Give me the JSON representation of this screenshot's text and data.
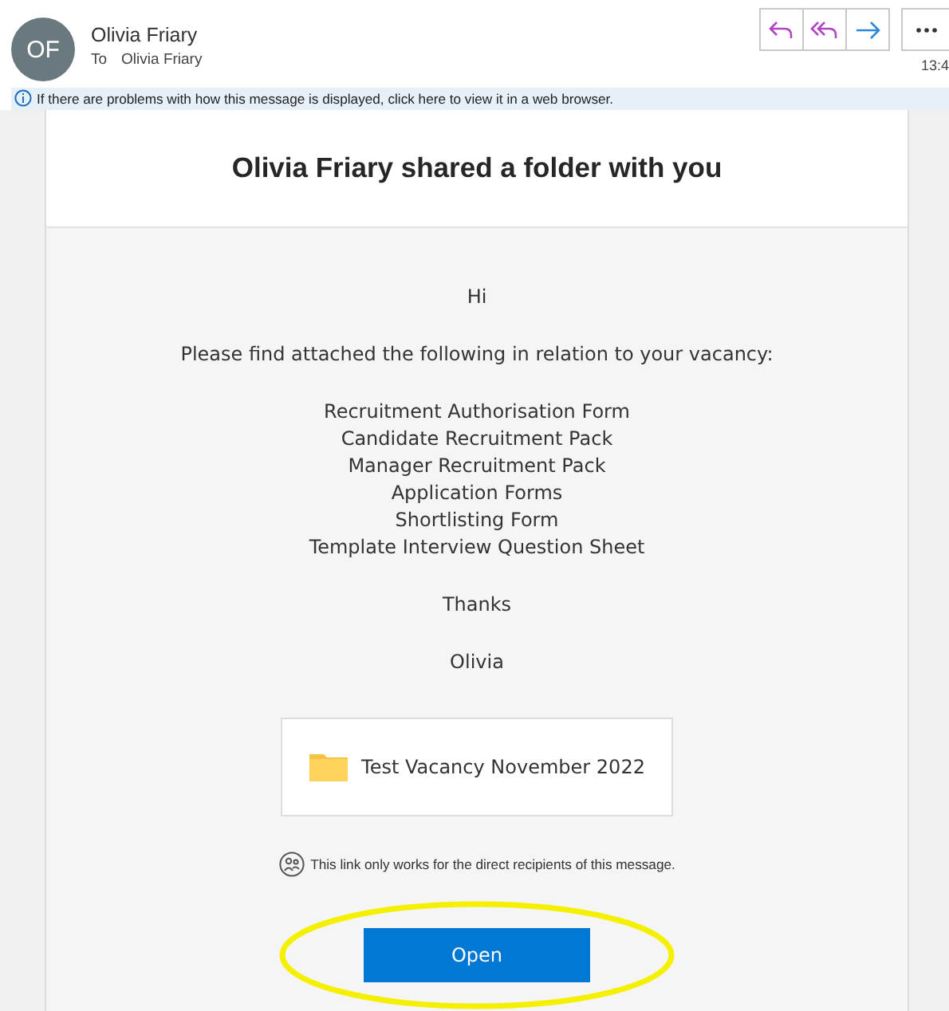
{
  "sender": {
    "initials": "OF",
    "name": "Olivia Friary",
    "to_label": "To",
    "to": "Olivia Friary",
    "time": "13:4"
  },
  "toolbar": [
    {
      "kind": "reply"
    },
    {
      "kind": "reply_all"
    },
    {
      "kind": "forward"
    },
    {
      "kind": "more"
    }
  ],
  "info_bar": "If there are problems with how this message is displayed, click here to view it in a web browser.",
  "card": {
    "title": "Olivia Friary shared a folder with you",
    "greeting": "Hi",
    "intro": "Please find attached the following in relation to your vacancy:",
    "items": [
      "Recruitment Authorisation Form",
      "Candidate Recruitment Pack",
      "Manager Recruitment Pack",
      "Application Forms",
      "Shortlisting Form",
      "Template Interview Question Sheet"
    ],
    "thanks": "Thanks",
    "signature": "Olivia",
    "folder": "Test Vacancy November 2022",
    "notice": "This link only works for the direct recipients of this message.",
    "button": "Open"
  }
}
